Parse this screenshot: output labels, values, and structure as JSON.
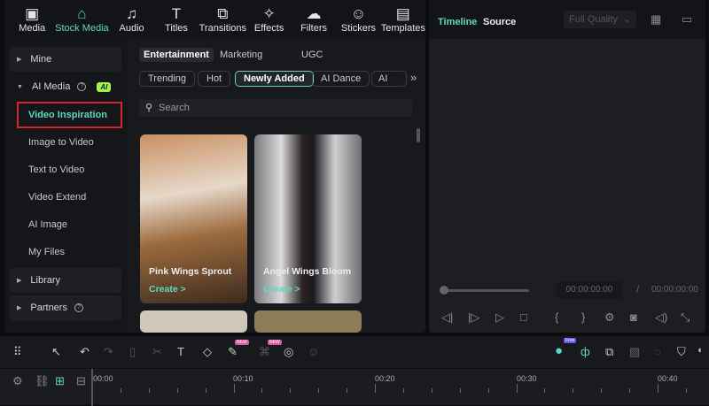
{
  "nav": [
    {
      "label": "Media",
      "icon": "media-icon"
    },
    {
      "label": "Stock Media",
      "icon": "stock-media-icon"
    },
    {
      "label": "Audio",
      "icon": "audio-icon"
    },
    {
      "label": "Titles",
      "icon": "titles-icon"
    },
    {
      "label": "Transitions",
      "icon": "transitions-icon"
    },
    {
      "label": "Effects",
      "icon": "effects-icon"
    },
    {
      "label": "Filters",
      "icon": "filters-icon"
    },
    {
      "label": "Stickers",
      "icon": "stickers-icon"
    },
    {
      "label": "Templates",
      "icon": "templates-icon"
    }
  ],
  "sidebar": {
    "mine": "Mine",
    "ai_media": "AI Media",
    "ai_badge": "AI",
    "items": [
      "Video Inspiration",
      "Image to Video",
      "Text to Video",
      "Video Extend",
      "AI Image",
      "My Files"
    ],
    "library": "Library",
    "partners": "Partners"
  },
  "content": {
    "tabs": [
      "Entertainment",
      "Marketing",
      "UGC"
    ],
    "chips": [
      "Trending",
      "Hot",
      "Newly Added",
      "AI Dance",
      "AI Kis"
    ],
    "more": "»",
    "search_placeholder": "Search",
    "cards": [
      {
        "title": "Pink Wings Sprout",
        "action": "Create >"
      },
      {
        "title": "Angel Wings Bloom",
        "action": "Create >"
      }
    ]
  },
  "preview": {
    "tabs": [
      "Timeline",
      "Source"
    ],
    "quality": "Full Quality",
    "current_time": "00:00:00:00",
    "separator": "/",
    "total_time": "00:00:00:00",
    "progress": 0
  },
  "timeline": {
    "badges": [
      "NEW",
      "NEW",
      "Free"
    ],
    "labels": [
      "00:00",
      "00:10",
      "00:20",
      "00:30",
      "00:40"
    ]
  },
  "colors": {
    "accent": "#5ed8c2",
    "highlight": "#d4252b"
  }
}
